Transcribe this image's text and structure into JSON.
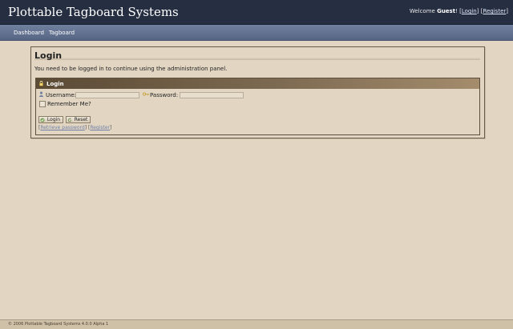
{
  "header": {
    "site_title": "Plottable Tagboard Systems",
    "welcome_prefix": "Welcome",
    "welcome_user": "Guest",
    "welcome_suffix": "!",
    "login_link": "Login",
    "register_link": "Register"
  },
  "nav": {
    "items": [
      {
        "label": "Dashboard"
      },
      {
        "label": "Tagboard"
      }
    ]
  },
  "main": {
    "title": "Login",
    "notice": "You need to be logged in to continue using the administration panel.",
    "login_box": {
      "heading": "Login",
      "username_label": "Username:",
      "username_value": "",
      "password_label": "Password:",
      "password_value": "",
      "remember_label": "Remember Me?",
      "remember_checked": false,
      "login_button": "Login",
      "reset_button": "Reset",
      "retrieve_password_link": "Retrieve password",
      "register_link": "Register"
    }
  },
  "footer": {
    "text": "© 2006 Plottable Tagboard Systems 4.0.0 Alpha 1"
  },
  "colors": {
    "header_bg": "#262e42",
    "nav_bg": "#627190",
    "page_bg": "#e2d6c3",
    "box_header": "#5b4a34"
  }
}
